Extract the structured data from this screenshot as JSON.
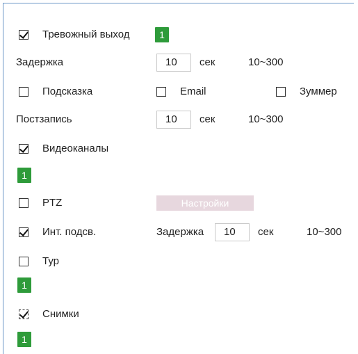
{
  "alarm_output": {
    "label": "Тревожный выход",
    "checked": true,
    "channel": "1"
  },
  "delay": {
    "label": "Задержка",
    "value": "10",
    "unit": "сек",
    "range": "10~300"
  },
  "notify": {
    "hint": {
      "label": "Подсказка",
      "checked": false
    },
    "email": {
      "label": "Email",
      "checked": false
    },
    "buzzer": {
      "label": "Зуммер",
      "checked": false
    }
  },
  "post_record": {
    "label": "Постзапись",
    "value": "10",
    "unit": "сек",
    "range": "10~300"
  },
  "video_channels": {
    "label": "Видеоканалы",
    "checked": true,
    "channel": "1"
  },
  "ptz": {
    "label": "PTZ",
    "checked": false,
    "settings_button": "Настройки"
  },
  "ir_light": {
    "label": "Инт. подсв.",
    "checked": true,
    "delay_label": "Задержка",
    "value": "10",
    "unit": "сек",
    "range": "10~300"
  },
  "tour": {
    "label": "Тур",
    "checked": false,
    "channel": "1"
  },
  "snapshots": {
    "label": "Снимки",
    "checked": true,
    "channel": "1"
  },
  "colors": {
    "border": "#6b96c7",
    "badge_green": "#2e9b3a",
    "disabled_button": "#e7d7de"
  }
}
